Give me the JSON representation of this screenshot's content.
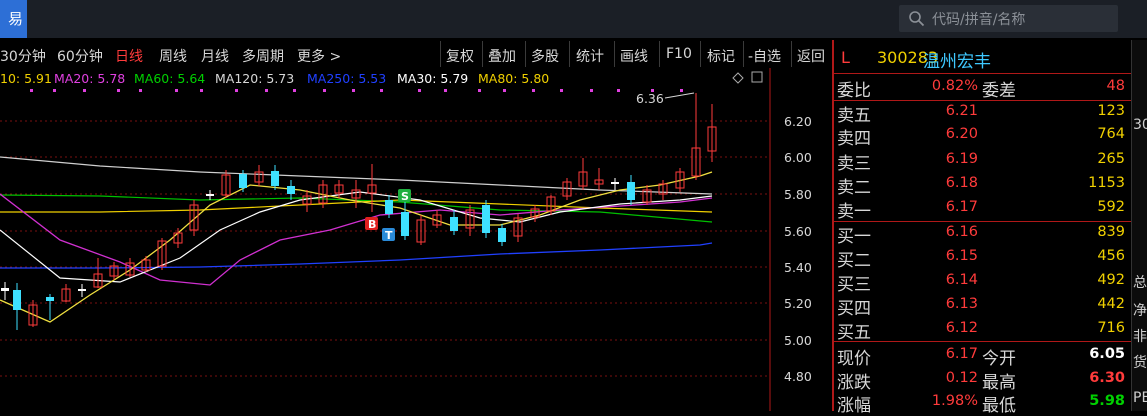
{
  "topbar": {
    "active_tab": "易",
    "search_placeholder": "代码/拼音/名称",
    "search_icon": "search-icon"
  },
  "toolbar": {
    "periods": [
      "30分钟",
      "60分钟",
      "日线",
      "周线",
      "月线",
      "多周期",
      "更多 >"
    ],
    "active_period": "日线",
    "actions": [
      "复权",
      "叠加",
      "多股",
      "统计",
      "画线",
      "F10",
      "标记",
      "-自选",
      "返回"
    ]
  },
  "ma_legend": [
    {
      "text": "10: 5.91",
      "color": "#f0d000"
    },
    {
      "text": "MA20: 5.78",
      "color": "#e040e0"
    },
    {
      "text": "MA60: 5.64",
      "color": "#00d000"
    },
    {
      "text": "MA120: 5.73",
      "color": "#d7d7d7"
    },
    {
      "text": "MA250: 5.53",
      "color": "#2040ff"
    },
    {
      "text": "MA30: 5.79",
      "color": "#ffffff"
    },
    {
      "text": "MA80: 5.80",
      "color": "#f0d000"
    }
  ],
  "chart_data": {
    "type": "candlestick",
    "y_ticks": [
      "6.20",
      "6.00",
      "5.80",
      "5.60",
      "5.40",
      "5.20",
      "5.00",
      "4.80"
    ],
    "high_annotation": "6.36",
    "markers": [
      "B",
      "T",
      "S"
    ]
  },
  "quote": {
    "market": "L",
    "code": "300283",
    "name": "温州宏丰",
    "weibi_label": "委比",
    "weibi": "0.82%",
    "weicha_label": "委差",
    "weicha": "48",
    "asks": [
      {
        "label": "卖五",
        "price": "6.21",
        "vol": "123"
      },
      {
        "label": "卖四",
        "price": "6.20",
        "vol": "764"
      },
      {
        "label": "卖三",
        "price": "6.19",
        "vol": "265"
      },
      {
        "label": "卖二",
        "price": "6.18",
        "vol": "1153"
      },
      {
        "label": "卖一",
        "price": "6.17",
        "vol": "592"
      }
    ],
    "bids": [
      {
        "label": "买一",
        "price": "6.16",
        "vol": "839"
      },
      {
        "label": "买二",
        "price": "6.15",
        "vol": "456"
      },
      {
        "label": "买三",
        "price": "6.14",
        "vol": "492"
      },
      {
        "label": "买四",
        "price": "6.13",
        "vol": "442"
      },
      {
        "label": "买五",
        "price": "6.12",
        "vol": "716"
      }
    ],
    "stats": [
      {
        "l1": "现价",
        "v1": "6.17",
        "l2": "今开",
        "v2": "6.05"
      },
      {
        "l1": "涨跌",
        "v1": "0.12",
        "l2": "最高",
        "v2": "6.30"
      },
      {
        "l1": "涨幅",
        "v1": "1.98%",
        "l2": "最低",
        "v2": "5.98"
      }
    ]
  },
  "right_strip": [
    "30",
    "总",
    "净",
    "非",
    "货",
    "PE"
  ]
}
